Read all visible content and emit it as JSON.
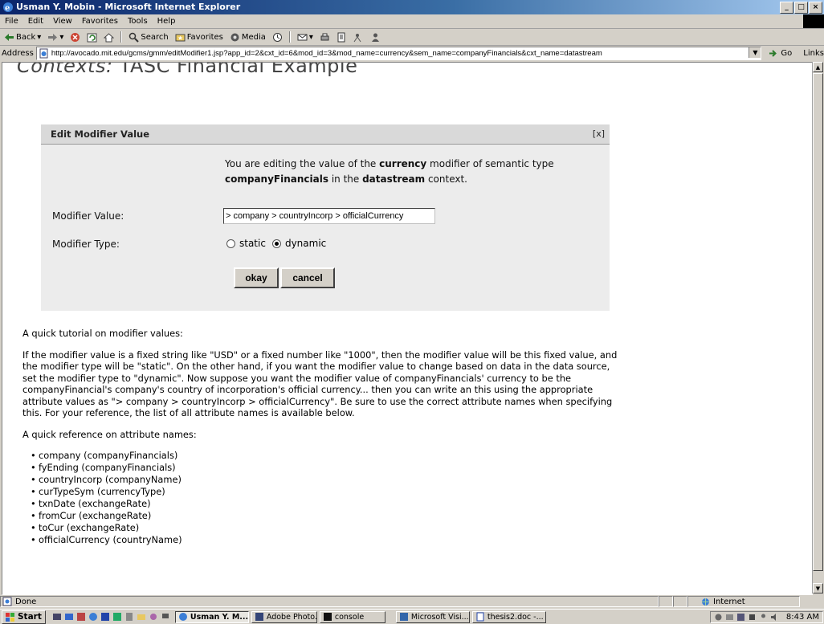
{
  "window": {
    "title": "Usman Y. Mobin - Microsoft Internet Explorer",
    "controls": [
      "_",
      "□",
      "×"
    ]
  },
  "menu": [
    "File",
    "Edit",
    "View",
    "Favorites",
    "Tools",
    "Help"
  ],
  "toolbar": {
    "back": "Back",
    "search": "Search",
    "favorites": "Favorites",
    "media": "Media"
  },
  "address": {
    "label": "Address",
    "url": "http://avocado.mit.edu/gcms/gmm/editModifier1.jsp?app_id=2&cxt_id=6&mod_id=3&mod_name=currency&sem_name=companyFinancials&cxt_name=datastream",
    "go": "Go",
    "links": "Links"
  },
  "page": {
    "heading_italic": "Contexts:",
    "heading_rest": " TASC Financial Example"
  },
  "modal": {
    "title": "Edit Modifier Value",
    "close": "[x]",
    "intro_1": "You are editing the value of the ",
    "modifier": "currency",
    "intro_2": " modifier of semantic type",
    "semantic_type": "companyFinancials",
    "intro_3": " in the ",
    "context": "datastream",
    "intro_4": " context.",
    "value_label": "Modifier Value:",
    "value": "> company > countryIncorp > officialCurrency",
    "type_label": "Modifier Type:",
    "type_options": [
      "static",
      "dynamic"
    ],
    "type_selected": "dynamic",
    "okay": "okay",
    "cancel": "cancel"
  },
  "tutorial": {
    "heading1": "A quick tutorial on modifier values:",
    "body": "If the modifier value is a fixed string like \"USD\" or a fixed number like \"1000\", then the modifier value will be this fixed value, and the modifier type will be \"static\". On the other hand, if you want the modifier value to change based on data in the data source, set the modifier type to \"dynamic\". Now suppose you want the modifier value of companyFinancials' currency to be the companyFinancial's company's country of incorporation's official currency... then you can write an this using the appropriate attribute values as \"> company > countryIncorp > officialCurrency\". Be sure to use the correct attribute names when specifying this. For your reference, the list of all attribute names is available below.",
    "heading2": "A quick reference on attribute names:",
    "attributes": [
      "company (companyFinancials)",
      "fyEnding (companyFinancials)",
      "countryIncorp (companyName)",
      "curTypeSym (currencyType)",
      "txnDate (exchangeRate)",
      "fromCur (exchangeRate)",
      "toCur (exchangeRate)",
      "officialCurrency (countryName)"
    ]
  },
  "status": {
    "text": "Done",
    "zone": "Internet"
  },
  "taskbar": {
    "start": "Start",
    "tasks": [
      "Usman Y. M...",
      "Adobe Photo...",
      "console",
      "Microsoft Visi...",
      "thesis2.doc -..."
    ],
    "active_task": "Usman Y. M...",
    "clock": "8:43 AM"
  }
}
